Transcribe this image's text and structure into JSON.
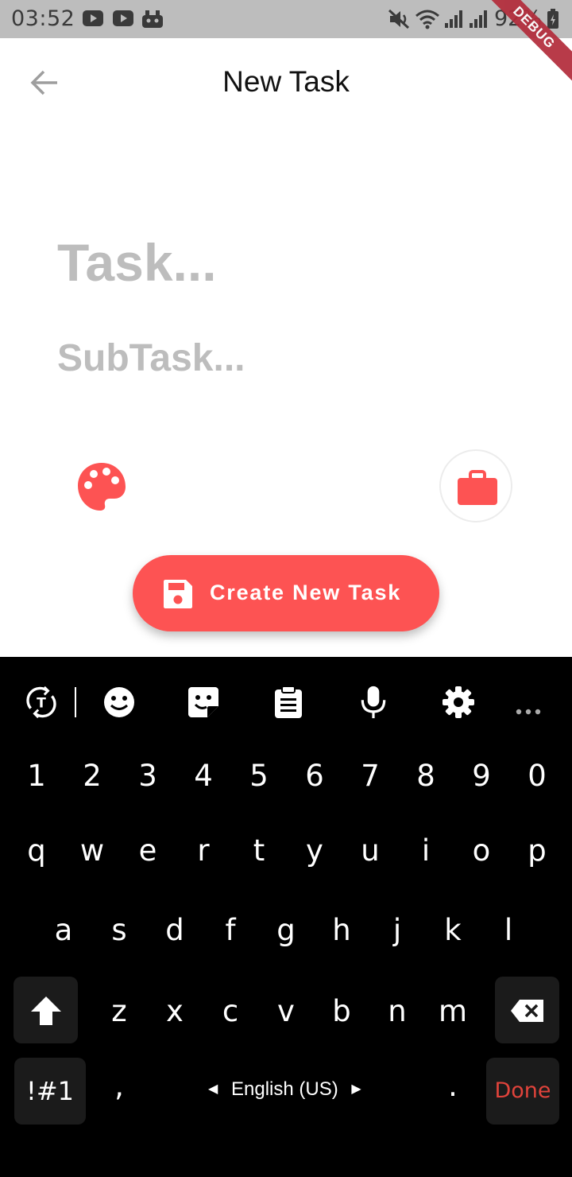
{
  "status_bar": {
    "time": "03:52",
    "battery": "92%",
    "debug_banner": "DEBUG",
    "icons": [
      "youtube-icon",
      "youtube-icon",
      "game-icon",
      "mute-icon",
      "wifi-icon",
      "signal-icon",
      "signal-icon",
      "battery-icon"
    ]
  },
  "app_bar": {
    "title": "New Task",
    "back_icon": "arrow-left-icon"
  },
  "form": {
    "task_placeholder": "Task...",
    "task_value": "",
    "subtask_placeholder": "SubTask...",
    "subtask_value": ""
  },
  "actions": {
    "palette_icon": "palette-icon",
    "category_icon": "briefcase-icon",
    "create_label": "Create New Task",
    "create_icon": "save-icon"
  },
  "colors": {
    "accent": "#fd5353",
    "status_bar_bg": "#bdbdbd",
    "keyboard_bg": "#000000",
    "done_text": "#e0433b"
  },
  "keyboard": {
    "toolbar": [
      "text-mode-icon",
      "emoji-icon",
      "sticker-icon",
      "clipboard-icon",
      "microphone-icon",
      "settings-icon",
      "more-icon"
    ],
    "numbers": [
      "1",
      "2",
      "3",
      "4",
      "5",
      "6",
      "7",
      "8",
      "9",
      "0"
    ],
    "row1": [
      "q",
      "w",
      "e",
      "r",
      "t",
      "y",
      "u",
      "i",
      "o",
      "p"
    ],
    "row2": [
      "a",
      "s",
      "d",
      "f",
      "g",
      "h",
      "j",
      "k",
      "l"
    ],
    "row3": [
      "z",
      "x",
      "c",
      "v",
      "b",
      "n",
      "m"
    ],
    "symbols_label": "!#1",
    "comma": ",",
    "period": ".",
    "language": "English (US)",
    "done_label": "Done"
  }
}
